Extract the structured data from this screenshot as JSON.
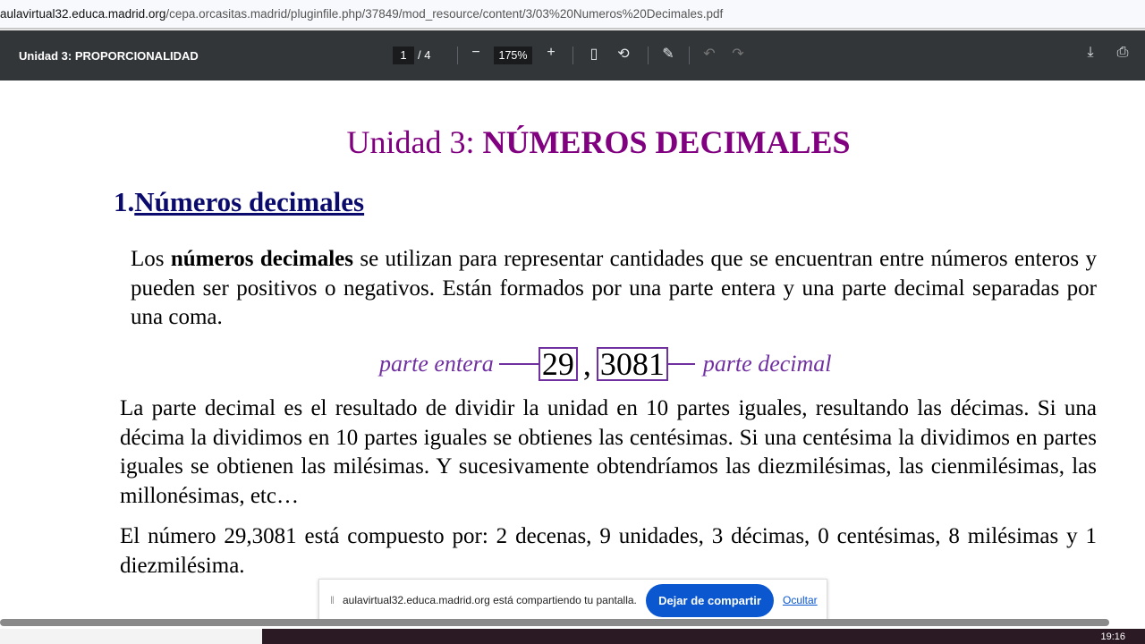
{
  "browser": {
    "url_host": "aulavirtual32.educa.madrid.org",
    "url_path": "/cepa.orcasitas.madrid/pluginfile.php/37849/mod_resource/content/3/03%20Numeros%20Decimales.pdf"
  },
  "toolbar": {
    "title": "Unidad 3: PROPORCIONALIDAD",
    "page": "1",
    "total": "/  4",
    "zoom": "175%"
  },
  "doc": {
    "title_prefix": "Unidad 3: ",
    "title_main": "NÚMEROS DECIMALES",
    "section_num": "1.",
    "section_title": "Números decimales",
    "p1_a": "Los ",
    "p1_b": "números decimales",
    "p1_c": " se utilizan para representar cantidades que se encuentran entre números enteros y pueden ser positivos o negativos. Están formados por una parte entera y una parte decimal separadas por una coma.",
    "diagram": {
      "left": "parte entera",
      "int": "29",
      "comma": ",",
      "dec": "3081",
      "right": "parte decimal"
    },
    "p2": "La parte decimal es el resultado de dividir la unidad en 10 partes iguales, resultando las décimas. Si una décima la dividimos en 10 partes iguales se obtienes las centésimas. Si una centésima la dividimos en partes iguales se obtienen las milésimas. Y sucesivamente obtendríamos las diezmilésimas, las cienmilésimas, las millonésimas, etc…",
    "p3": "El número 29,3081 está compuesto por: 2 decenas, 9 unidades, 3 décimas, 0 centésimas, 8 milésimas y 1 diezmilésima."
  },
  "share": {
    "text": "aulavirtual32.educa.madrid.org está compartiendo tu pantalla.",
    "stop": "Dejar de compartir",
    "hide": "Ocultar"
  },
  "taskbar": {
    "time": "19:16"
  }
}
